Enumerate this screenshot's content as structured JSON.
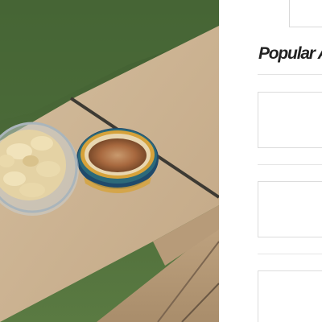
{
  "sidebar": {
    "popular_heading": "Popular Ar"
  },
  "colors": {
    "grass": "#4d6a3a",
    "ledge": "#c8b091",
    "bowl_rim": "#2c6a7a",
    "hummus": "#a36a44",
    "card_border": "#dcdcdc"
  },
  "icons": {
    "hero": "photo-hummus-and-chips"
  }
}
